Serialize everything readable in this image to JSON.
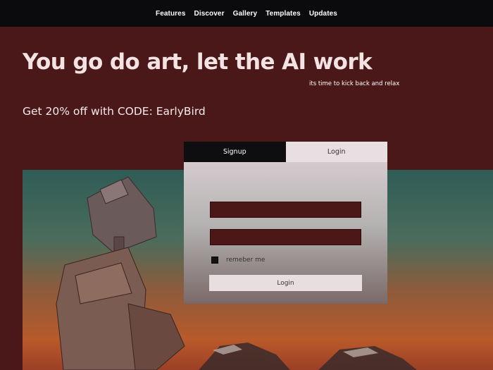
{
  "nav": {
    "items": [
      {
        "label": "Features"
      },
      {
        "label": "Discover"
      },
      {
        "label": "Gallery"
      },
      {
        "label": "Templates"
      },
      {
        "label": "Updates"
      }
    ]
  },
  "hero": {
    "title": "You go do art, let the AI work",
    "subtitle": "its time to kick back and relax",
    "promo": "Get 20% off with CODE: EarlyBird"
  },
  "auth": {
    "tabs": [
      {
        "label": "Signup",
        "active": true
      },
      {
        "label": "Login",
        "active": false
      }
    ],
    "username_value": "",
    "password_value": "",
    "remember_label": "remeber me",
    "login_button": "Login"
  },
  "colors": {
    "page_bg": "#4a1818",
    "nav_bg": "#0b0b0d",
    "field_bg": "#4d1515",
    "button_bg": "#ece3e6"
  },
  "icons": {
    "checkbox": "checkbox-filled"
  }
}
